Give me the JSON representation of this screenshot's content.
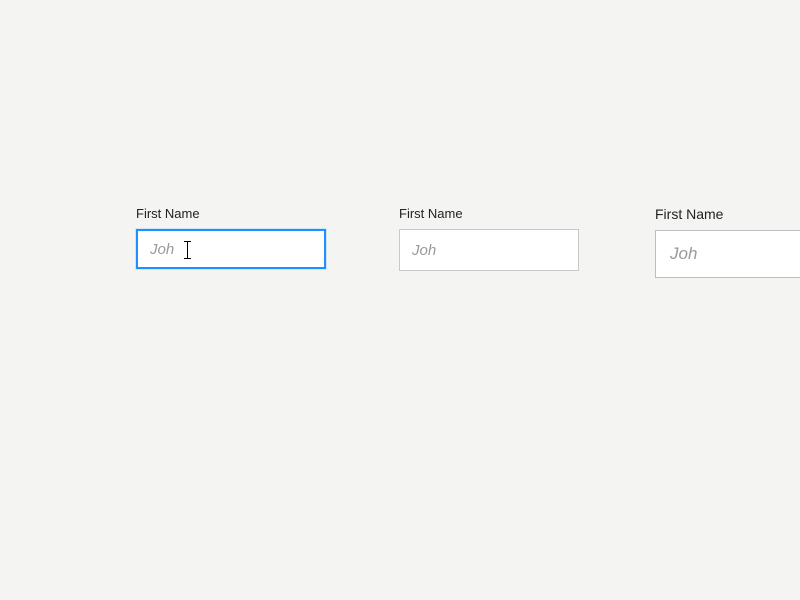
{
  "fields": {
    "first": {
      "label": "First Name",
      "placeholder": "Joh"
    },
    "second": {
      "label": "First Name",
      "placeholder": "Joh"
    },
    "third": {
      "label": "First Name",
      "placeholder": "Joh"
    }
  }
}
